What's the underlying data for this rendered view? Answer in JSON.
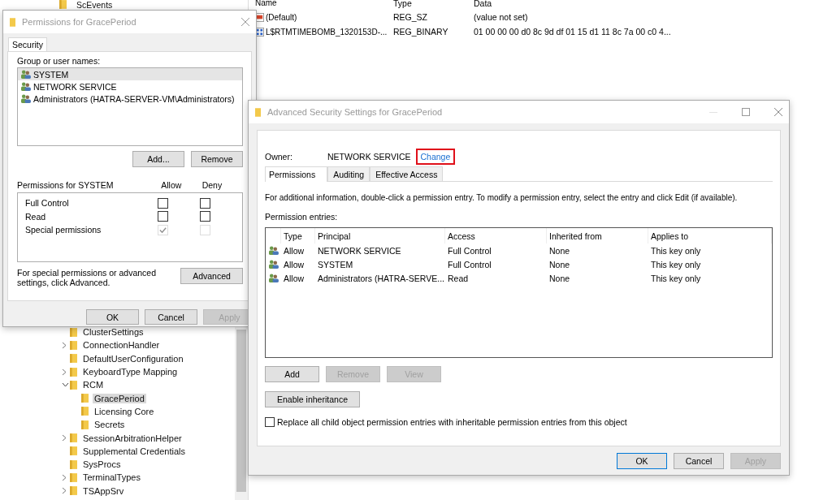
{
  "regedit": {
    "tree": {
      "partial_item": "ScEvents",
      "items": [
        {
          "label": "ClusterSettings",
          "selected": false
        },
        {
          "label": "ConnectionHandler",
          "expanded": false,
          "selected": false
        },
        {
          "label": "DefaultUserConfiguration",
          "selected": false
        },
        {
          "label": "KeyboardType Mapping",
          "expanded": false,
          "selected": false
        },
        {
          "label": "RCM",
          "expanded": true,
          "selected": false,
          "children": [
            {
              "label": "GracePeriod",
              "selected": true
            },
            {
              "label": "Licensing Core",
              "selected": false
            },
            {
              "label": "Secrets",
              "selected": false
            }
          ]
        },
        {
          "label": "SessionArbitrationHelper",
          "expanded": false,
          "selected": false
        },
        {
          "label": "Supplemental Credentials",
          "selected": false
        },
        {
          "label": "SysProcs",
          "selected": false
        },
        {
          "label": "TerminalTypes",
          "expanded": false,
          "selected": false
        },
        {
          "label": "TSAppSrv",
          "expanded": false,
          "selected": false
        }
      ]
    },
    "values": {
      "columns": [
        "Name",
        "Type",
        "Data"
      ],
      "rows": [
        {
          "kind": "string",
          "name": "(Default)",
          "type": "REG_SZ",
          "data": "(value not set)"
        },
        {
          "kind": "binary",
          "name": "L$RTMTIMEBOMB_1320153D-...",
          "type": "REG_BINARY",
          "data": "01 00 00 00 d0 8c 9d df 01 15 d1 11 8c 7a 00 c0 4..."
        }
      ]
    }
  },
  "permissions_dialog": {
    "title": "Permissions for GracePeriod",
    "tabs": [
      {
        "label": "Security",
        "selected": true
      }
    ],
    "group_label": "Group or user names:",
    "users": [
      {
        "name": "SYSTEM",
        "selected": true
      },
      {
        "name": "NETWORK SERVICE",
        "selected": false
      },
      {
        "name": "Administrators (HATRA-SERVER-VM\\Administrators)",
        "selected": false
      }
    ],
    "user_buttons": [
      {
        "label": "Add...",
        "disabled": false
      },
      {
        "label": "Remove",
        "disabled": false
      }
    ],
    "permissions_label": "Permissions for SYSTEM",
    "allow_label": "Allow",
    "deny_label": "Deny",
    "permissions": [
      {
        "label": "Full Control",
        "allow": {
          "checked": false,
          "disabled": false
        },
        "deny": {
          "checked": false,
          "disabled": false
        }
      },
      {
        "label": "Read",
        "allow": {
          "checked": false,
          "disabled": false
        },
        "deny": {
          "checked": false,
          "disabled": false
        }
      },
      {
        "label": "Special permissions",
        "allow": {
          "checked": true,
          "disabled": true
        },
        "deny": {
          "checked": false,
          "disabled": true
        }
      }
    ],
    "note": "For special permissions or advanced settings, click Advanced.",
    "advanced_button": "Advanced",
    "footer_buttons": [
      {
        "label": "OK",
        "disabled": false
      },
      {
        "label": "Cancel",
        "disabled": false
      },
      {
        "label": "Apply",
        "disabled": true
      }
    ]
  },
  "advanced_dialog": {
    "title": "Advanced Security Settings for GracePeriod",
    "owner_label": "Owner:",
    "owner": "NETWORK SERVICE",
    "change_link": {
      "label": "Change",
      "highlighted": true
    },
    "tabs": [
      {
        "label": "Permissions",
        "selected": true
      },
      {
        "label": "Auditing",
        "selected": false
      },
      {
        "label": "Effective Access",
        "selected": false
      }
    ],
    "info": "For additional information, double-click a permission entry. To modify a permission entry, select the entry and click Edit (if available).",
    "entries_label": "Permission entries:",
    "columns": [
      "Type",
      "Principal",
      "Access",
      "Inherited from",
      "Applies to"
    ],
    "rows": [
      {
        "type": "Allow",
        "principal": "NETWORK SERVICE",
        "access": "Full Control",
        "inherited_from": "None",
        "applies_to": "This key only"
      },
      {
        "type": "Allow",
        "principal": "SYSTEM",
        "access": "Full Control",
        "inherited_from": "None",
        "applies_to": "This key only"
      },
      {
        "type": "Allow",
        "principal": "Administrators (HATRA-SERVE...",
        "access": "Read",
        "inherited_from": "None",
        "applies_to": "This key only"
      }
    ],
    "action_buttons": [
      {
        "label": "Add",
        "disabled": false
      },
      {
        "label": "Remove",
        "disabled": true
      },
      {
        "label": "View",
        "disabled": true
      }
    ],
    "inheritance_button": "Enable inheritance",
    "replace_option": {
      "label": "Replace all child object permission entries with inheritable permission entries from this object",
      "checked": false
    },
    "footer_buttons": [
      {
        "label": "OK",
        "disabled": false,
        "default": true
      },
      {
        "label": "Cancel",
        "disabled": false,
        "default": false
      },
      {
        "label": "Apply",
        "disabled": true,
        "default": false
      }
    ]
  }
}
